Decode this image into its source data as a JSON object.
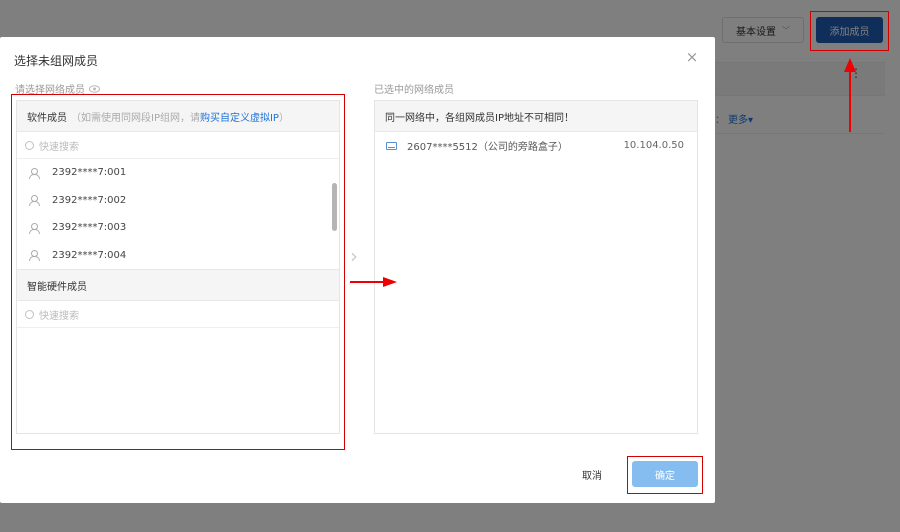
{
  "background": {
    "settings_label": "基本设置",
    "settings_chevron": "﹀",
    "add_member_label": "添加成员",
    "more_label": "更多▾",
    "colon_text": "：",
    "dots": "⋮"
  },
  "modal": {
    "title": "选择未组网成员",
    "close_icon": "×",
    "left_title": "请选择网络成员",
    "right_title": "已选中的网络成员",
    "software_section": {
      "title": "软件成员",
      "hint_prefix": "（如需使用同网段IP组网，请",
      "hint_link": "购买自定义虚拟IP",
      "hint_suffix": "）",
      "search_placeholder": "快速搜索",
      "members": [
        {
          "name": "2392****7:001"
        },
        {
          "name": "2392****7:002"
        },
        {
          "name": "2392****7:003"
        },
        {
          "name": "2392****7:004"
        }
      ]
    },
    "hardware_section": {
      "title": "智能硬件成员",
      "search_placeholder": "快速搜索"
    },
    "transfer_arrow": "›",
    "right_notice": "同一网络中，各组网成员IP地址不可相同！",
    "selected": [
      {
        "name": "2607****5512（公司的旁路盒子）",
        "ip": "10.104.0.50"
      }
    ],
    "cancel_label": "取消",
    "ok_label": "确定"
  },
  "colors": {
    "primary": "#1e5fb4",
    "ok_disabled": "#86bdf0",
    "link": "#1e73d8",
    "annotation": "#ee0000"
  }
}
